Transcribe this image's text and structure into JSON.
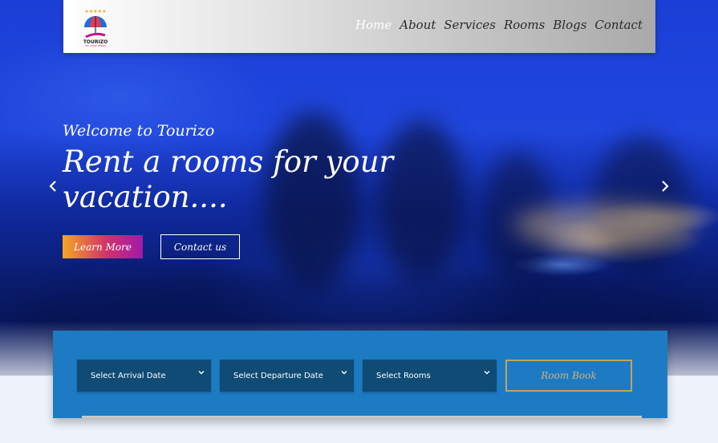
{
  "brand": {
    "name": "TOURIZO",
    "tagline": "THE LUXURY RESORT",
    "stars": "★★★★★"
  },
  "nav": {
    "items": [
      {
        "label": "Home",
        "active": true
      },
      {
        "label": "About"
      },
      {
        "label": "Services"
      },
      {
        "label": "Rooms"
      },
      {
        "label": "Blogs"
      },
      {
        "label": "Contact"
      }
    ]
  },
  "hero": {
    "welcome": "Welcome to Tourizo",
    "headline": "Rent a rooms for your vacation....",
    "learn_more": "Learn More",
    "contact_us": "Contact us",
    "prev_icon": "chevron-left-icon",
    "next_icon": "chevron-right-icon"
  },
  "booking": {
    "arrival": "Select Arrival Date",
    "departure": "Select Departure Date",
    "rooms": "Select Rooms",
    "book": "Room Book"
  },
  "colors": {
    "accent": "#1d7bc4",
    "select_bg": "#0f4b74",
    "book_border": "#c9a15a",
    "gradient_start": "#f6a623",
    "gradient_end": "#a11aa8"
  }
}
